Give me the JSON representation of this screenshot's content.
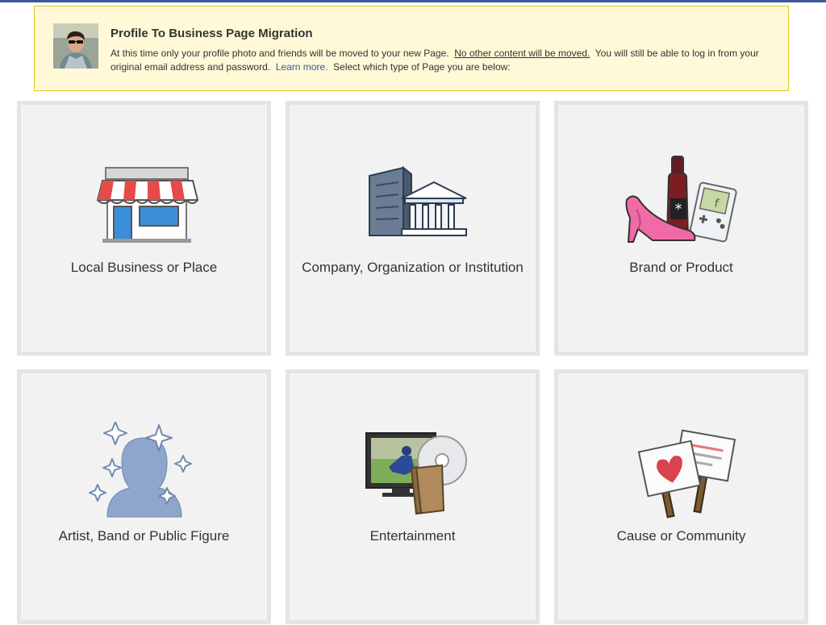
{
  "notice": {
    "title": "Profile To Business Page Migration",
    "text_1": "At this time only your profile photo and friends will be moved to your new Page.",
    "text_underlined": "No other content will be moved.",
    "text_2": "You will still be able to log in from your original email address and password.",
    "learn_more": "Learn more.",
    "text_3": "Select which type of Page you are below:"
  },
  "categories": [
    {
      "label": "Local Business or Place",
      "icon": "storefront-icon"
    },
    {
      "label": "Company, Organization or Institution",
      "icon": "buildings-icon"
    },
    {
      "label": "Brand or Product",
      "icon": "products-icon"
    },
    {
      "label": "Artist, Band or Public Figure",
      "icon": "silhouette-icon"
    },
    {
      "label": "Entertainment",
      "icon": "media-icon"
    },
    {
      "label": "Cause or Community",
      "icon": "signs-icon"
    }
  ],
  "colors": {
    "accent": "#3b5998",
    "notice_bg": "#fff9d7",
    "notice_border": "#e2c822",
    "tile_bg": "#f2f2f2",
    "tile_border": "#e4e4e4"
  }
}
